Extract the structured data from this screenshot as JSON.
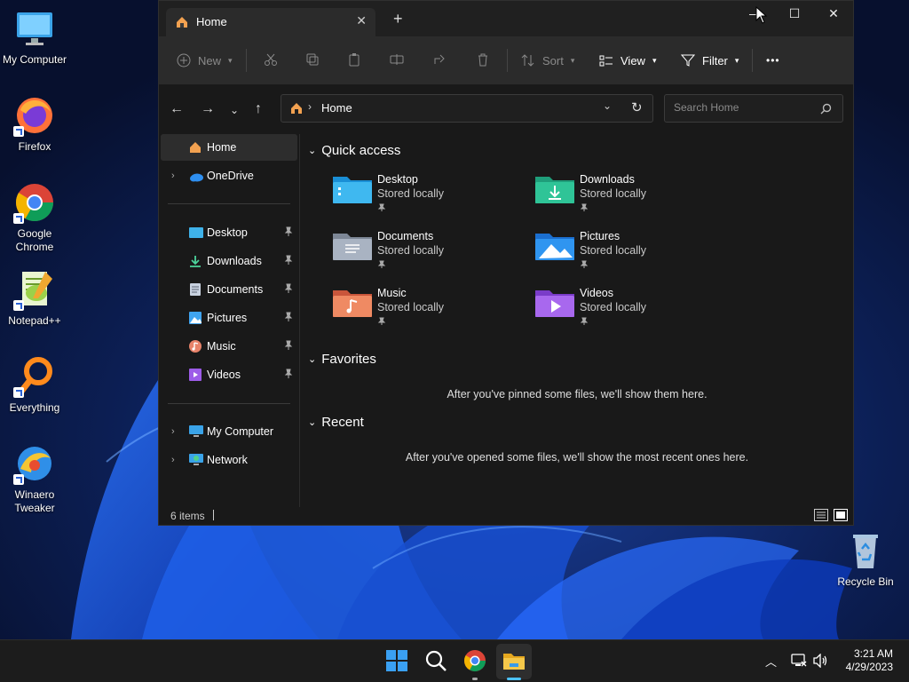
{
  "desktop": {
    "icons": [
      {
        "label": "My Computer"
      },
      {
        "label": "Firefox"
      },
      {
        "label": "Google Chrome"
      },
      {
        "label": "Notepad++"
      },
      {
        "label": "Everything"
      },
      {
        "label": "Winaero Tweaker"
      },
      {
        "label": "Recycle Bin"
      }
    ]
  },
  "window": {
    "tab_title": "Home",
    "new_tab": "+",
    "controls": {
      "minimize": "—",
      "maximize": "☐",
      "close": "✕"
    },
    "toolbar": {
      "new": "New",
      "sort": "Sort",
      "view": "View",
      "filter": "Filter",
      "more": "•••"
    },
    "address": {
      "label": "Home"
    },
    "search": {
      "placeholder": "Search Home"
    },
    "sidebar": {
      "home": "Home",
      "onedrive": "OneDrive",
      "pinned": [
        "Desktop",
        "Downloads",
        "Documents",
        "Pictures",
        "Music",
        "Videos"
      ],
      "my_computer": "My Computer",
      "network": "Network"
    },
    "quick_access": {
      "heading": "Quick access",
      "items": [
        {
          "name": "Desktop",
          "status": "Stored locally"
        },
        {
          "name": "Downloads",
          "status": "Stored locally"
        },
        {
          "name": "Documents",
          "status": "Stored locally"
        },
        {
          "name": "Pictures",
          "status": "Stored locally"
        },
        {
          "name": "Music",
          "status": "Stored locally"
        },
        {
          "name": "Videos",
          "status": "Stored locally"
        }
      ]
    },
    "favorites": {
      "heading": "Favorites",
      "empty": "After you've pinned some files, we'll show them here."
    },
    "recent": {
      "heading": "Recent",
      "empty": "After you've opened some files, we'll show the most recent ones here."
    },
    "status": {
      "items": "6 items"
    }
  },
  "taskbar": {
    "time": "3:21 AM",
    "date": "4/29/2023"
  },
  "colors": {
    "accent": "#4cc2ff",
    "folder": "#f0c34a"
  }
}
